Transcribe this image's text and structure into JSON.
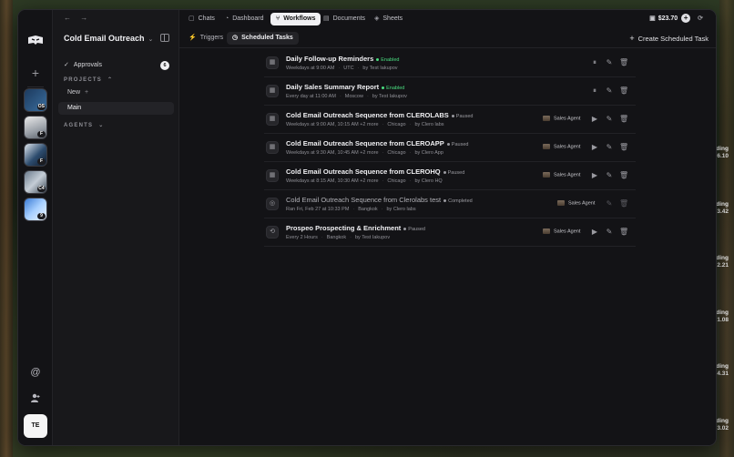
{
  "window": {
    "nav_back": "←",
    "nav_forward": "→"
  },
  "rail": {
    "workspaces": [
      {
        "badge": "OS"
      },
      {
        "badge": "F"
      },
      {
        "badge": "F"
      },
      {
        "badge": "C4"
      },
      {
        "badge": "9"
      }
    ],
    "user_initials": "TE"
  },
  "sidebar": {
    "title": "Cold Email Outreach",
    "approvals_label": "Approvals",
    "approvals_count": "6",
    "projects_heading": "PROJECTS",
    "new_label": "New",
    "main_label": "Main",
    "agents_heading": "AGENTS"
  },
  "topbar": {
    "tabs": [
      {
        "label": "Chats",
        "icon": "chat-icon"
      },
      {
        "label": "Dashboard",
        "icon": "dashboard-icon"
      },
      {
        "label": "Workflows",
        "icon": "workflows-icon"
      },
      {
        "label": "Documents",
        "icon": "document-icon"
      },
      {
        "label": "Sheets",
        "icon": "sheets-icon"
      }
    ],
    "active_tab": "Workflows",
    "credits": "$23.70"
  },
  "subbar": {
    "tabs": [
      {
        "label": "Triggers"
      },
      {
        "label": "Scheduled Tasks"
      }
    ],
    "active_tab": "Scheduled Tasks",
    "create_label": "Create Scheduled Task"
  },
  "tasks": [
    {
      "name": "Daily Follow-up Reminders",
      "status": "Enabled",
      "schedule": "Weekdays at 9:00 AM",
      "timezone": "UTC",
      "owner": "by Test Iakupov",
      "agent": ""
    },
    {
      "name": "Daily Sales Summary Report",
      "status": "Enabled",
      "schedule": "Every day at 11:00 AM",
      "timezone": "Moscow",
      "owner": "by Test Iakupov",
      "agent": ""
    },
    {
      "name": "Cold Email Outreach Sequence from CLEROLABS",
      "status": "Paused",
      "schedule": "Weekdays at 9:00 AM, 10:15 AM +2 more",
      "timezone": "Chicago",
      "owner": "by Clero labs",
      "agent": "Sales Agent"
    },
    {
      "name": "Cold Email Outreach Sequence from CLEROAPP",
      "status": "Paused",
      "schedule": "Weekdays at 9:30 AM, 10:45 AM +2 more",
      "timezone": "Chicago",
      "owner": "by Clero App",
      "agent": "Sales Agent"
    },
    {
      "name": "Cold Email Outreach Sequence from CLEROHQ",
      "status": "Paused",
      "schedule": "Weekdays at 8:15 AM, 10:30 AM +2 more",
      "timezone": "Chicago",
      "owner": "by Clero HQ",
      "agent": "Sales Agent"
    },
    {
      "name": "Cold Email Outreach Sequence from Clerolabs test",
      "status": "Completed",
      "schedule": "Ran Fri, Feb 27 at 10:33 PM",
      "timezone": "Bangkok",
      "owner": "by Clero labs",
      "agent": "Sales Agent"
    },
    {
      "name": "Prospeo Prospecting & Enrichment",
      "status": "Paused",
      "schedule": "Every 2 Hours",
      "timezone": "Bangkok",
      "owner": "by Test Iakupov",
      "agent": "Sales Agent"
    }
  ],
  "background_labels": [
    {
      "l1": "ding",
      "l2": "6.10"
    },
    {
      "l1": "ding",
      "l2": "3.42"
    },
    {
      "l1": "ding",
      "l2": "2.21"
    },
    {
      "l1": "ding",
      "l2": "1.08"
    },
    {
      "l1": "ding",
      "l2": "4.31"
    },
    {
      "l1": "ding",
      "l2": "3.02"
    }
  ],
  "colors": {
    "enabled": "#4ade80",
    "paused": "#9a9aa0",
    "accent_active_tab": "#f0f0f3"
  }
}
